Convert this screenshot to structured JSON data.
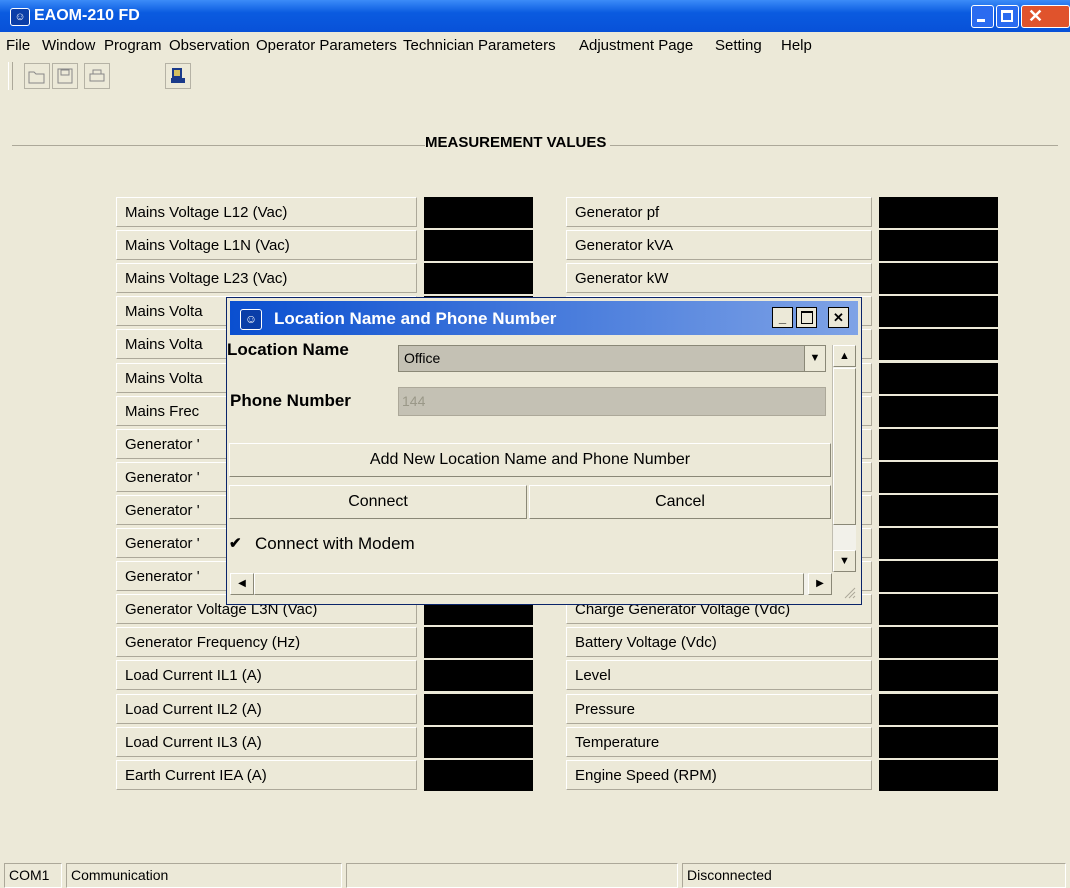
{
  "window": {
    "title": "EAOM-210 FD",
    "icon": "app-icon"
  },
  "menu": [
    "File",
    "Window",
    "Program",
    "Observation",
    "Operator Parameters",
    "Technician Parameters",
    "Adjustment Page",
    "Setting",
    "Help"
  ],
  "toolbar": [
    "open-folder-icon",
    "save-icon",
    "print-icon",
    "connect-icon"
  ],
  "section_title": "MEASUREMENT VALUES",
  "left_labels": [
    "Mains Voltage L12 (Vac)",
    "Mains Voltage L1N (Vac)",
    "Mains Voltage L23 (Vac)",
    "Mains Volta",
    "Mains Volta",
    "Mains Volta",
    "Mains Frec",
    "Generator '",
    "Generator '",
    "Generator '",
    "Generator '",
    "Generator '",
    "Generator Voltage L3N (Vac)",
    "Generator Frequency (Hz)",
    "Load Current IL1 (A)",
    "Load Current IL2 (A)",
    "Load Current IL3 (A)",
    "Earth Current IEA (A)"
  ],
  "right_labels": [
    "Generator pf",
    "Generator kVA",
    "Generator kW",
    "",
    "",
    "",
    "",
    "",
    "",
    "",
    "",
    "",
    "Charge Generator Voltage (Vdc)",
    "Battery Voltage (Vdc)",
    "Level",
    "Pressure",
    "Temperature",
    "Engine Speed (RPM)"
  ],
  "dialog": {
    "title": "Location Name and Phone Number",
    "location_label": "Location Name",
    "location_value": "Office",
    "phone_label": "Phone Number",
    "phone_value": "144",
    "add_button": "Add New Location Name and Phone Number",
    "connect_button": "Connect",
    "cancel_button": "Cancel",
    "modem_label": "Connect with Modem",
    "modem_checked": true
  },
  "status": {
    "port": "COM1",
    "comm": "Communication",
    "blank": "",
    "state": "Disconnected"
  }
}
